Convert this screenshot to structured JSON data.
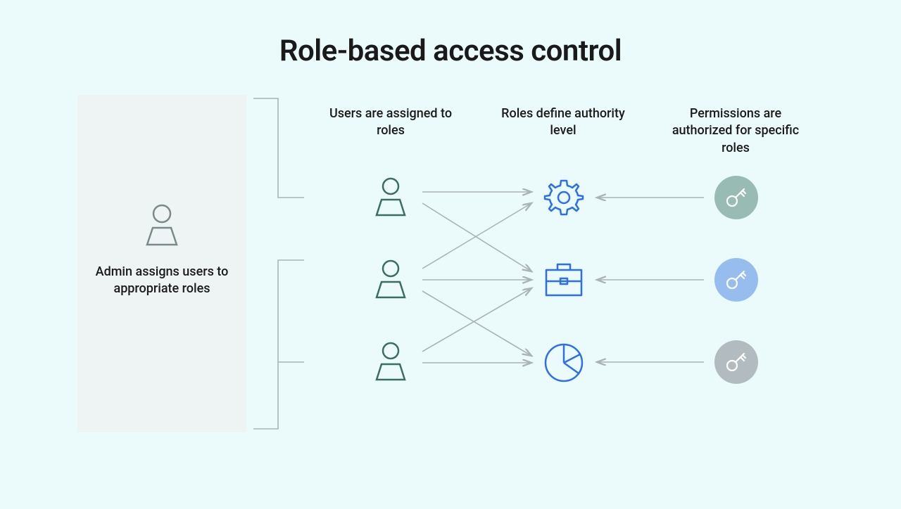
{
  "title": "Role-based access control",
  "admin": {
    "caption": "Admin assigns users to appropriate roles"
  },
  "columns": {
    "users": {
      "header": "Users are assigned to roles"
    },
    "roles": {
      "header": "Roles define authority level"
    },
    "permissions": {
      "header": "Permissions are authorized for specific roles"
    }
  },
  "colors": {
    "adminStroke": "#7a8a8a",
    "userStroke": "#3a6e64",
    "roleStroke": "#2b6ef2",
    "keyGreen": "#98bcb3",
    "keyBlue": "#97bdef",
    "keyGray": "#b2bbbf",
    "arrowGray": "#a9b3b8",
    "bracketGray": "#a9b3b8"
  },
  "diagram": {
    "users": 3,
    "roles": [
      "gear",
      "briefcase",
      "pie-chart"
    ],
    "permissions": [
      "green",
      "blue",
      "gray"
    ],
    "user_role_links": [
      [
        0,
        0
      ],
      [
        0,
        1
      ],
      [
        1,
        0
      ],
      [
        1,
        1
      ],
      [
        1,
        2
      ],
      [
        2,
        1
      ],
      [
        2,
        2
      ]
    ],
    "permission_role_links": [
      [
        0,
        0
      ],
      [
        1,
        1
      ],
      [
        2,
        2
      ]
    ]
  }
}
